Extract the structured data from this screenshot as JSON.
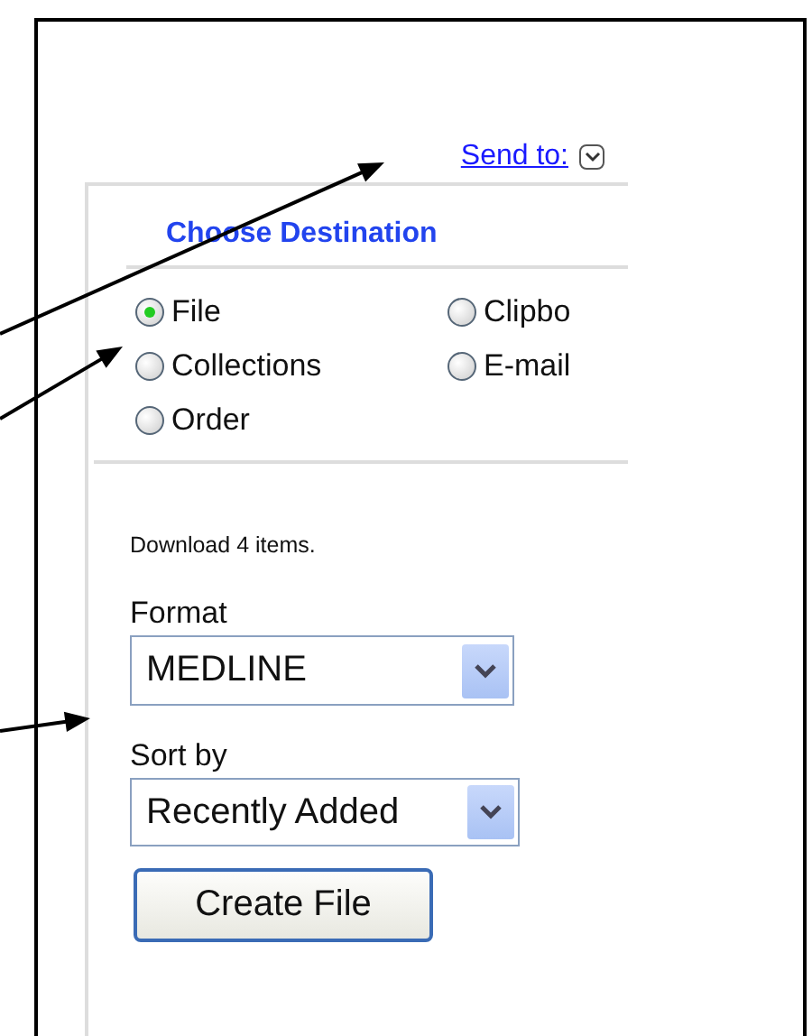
{
  "send_to": {
    "label": "Send to:"
  },
  "panel": {
    "title": "Choose Destination",
    "destinations": [
      {
        "label": "File",
        "selected": true
      },
      {
        "label": "Clipbo",
        "selected": false
      },
      {
        "label": "Collections",
        "selected": false
      },
      {
        "label": "E-mail",
        "selected": false
      },
      {
        "label": "Order",
        "selected": false
      }
    ],
    "summary": "Download 4 items.",
    "format": {
      "label": "Format",
      "value": "MEDLINE"
    },
    "sort": {
      "label": "Sort by",
      "value": "Recently Added"
    },
    "button": "Create File"
  }
}
